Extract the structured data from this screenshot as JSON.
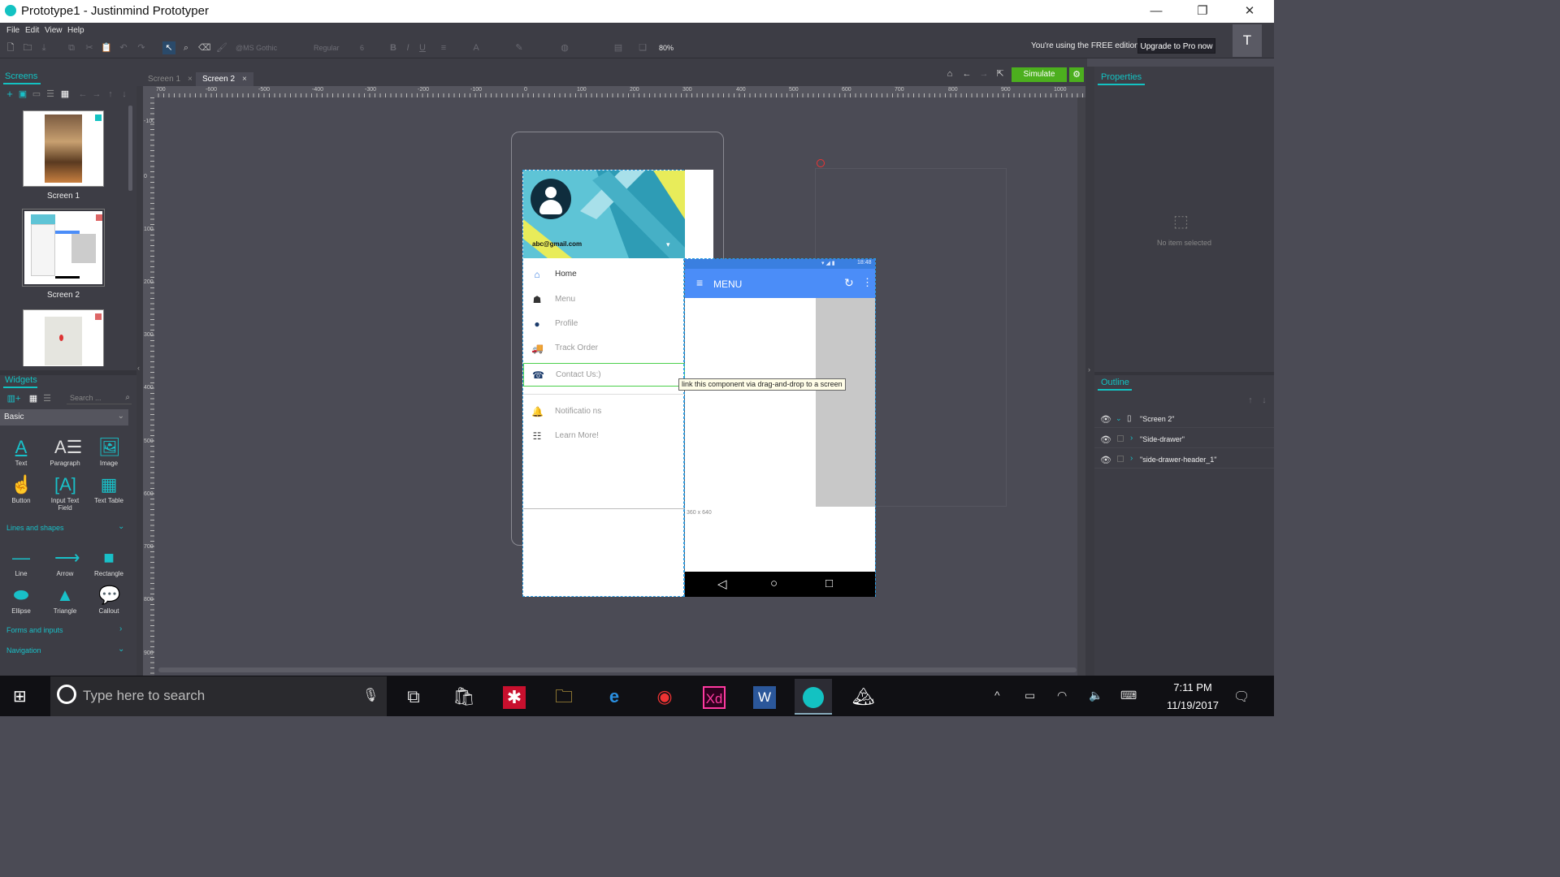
{
  "window": {
    "title": "Prototype1 - Justinmind Prototyper",
    "minimize": "—",
    "maximize": "❐",
    "close": "✕"
  },
  "menu": [
    "File",
    "Edit",
    "View",
    "Help"
  ],
  "toolbar": {
    "font_family": "@MS Gothic",
    "font_style": "Regular",
    "font_size": "6",
    "zoom": "80%",
    "free_edition_note": "You're using the FREE edition",
    "upgrade_label": "Upgrade to Pro now",
    "user_initial": "T"
  },
  "screens_panel": {
    "title": "Screens",
    "screens": [
      {
        "label": "Screen 1"
      },
      {
        "label": "Screen 2"
      },
      {
        "label": ""
      }
    ]
  },
  "widgets_panel": {
    "title": "Widgets",
    "search_placeholder": "Search ...",
    "category": "Basic",
    "basic": [
      "Text",
      "Paragraph",
      "Image",
      "Button",
      "Input Text Field",
      "Text Table"
    ],
    "lines_section": "Lines and shapes",
    "shapes": [
      "Line",
      "Arrow",
      "Rectangle",
      "Ellipse",
      "Triangle",
      "Callout"
    ],
    "forms_section": "Forms and inputs",
    "navigation_section": "Navigation"
  },
  "doc_tabs": [
    {
      "label": "Screen 1",
      "active": false
    },
    {
      "label": "Screen 2",
      "active": true
    }
  ],
  "simulate_label": "Simulate",
  "ruler_h": [
    "700",
    "-600",
    "-500",
    "-400",
    "-300",
    "-200",
    "-100",
    "0",
    "100",
    "200",
    "300",
    "400",
    "500",
    "600",
    "700",
    "800",
    "900",
    "1000"
  ],
  "ruler_v": [
    "-100",
    "0",
    "100",
    "200",
    "300",
    "400",
    "500",
    "600",
    "700",
    "800",
    "900"
  ],
  "canvas": {
    "drawer": {
      "email": "abc@gmail.com",
      "items": [
        {
          "label": "Home",
          "icon": "home-icon",
          "active": true
        },
        {
          "label": "Menu",
          "icon": "menu-food-icon"
        },
        {
          "label": "Profile",
          "icon": "profile-icon"
        },
        {
          "label": "Track Order",
          "icon": "track-order-icon"
        },
        {
          "label": "Contact Us:)",
          "icon": "contact-icon",
          "selected": true
        },
        {
          "label": "Notificatio ns",
          "icon": "bell-icon"
        },
        {
          "label": "Learn More!",
          "icon": "learn-more-icon"
        }
      ]
    },
    "appbar": {
      "title": "MENU",
      "time": "18:48"
    },
    "screen_size": "360 x 640",
    "tooltip": "link this component via drag-and-drop to a screen"
  },
  "properties_panel": {
    "title": "Properties",
    "empty_text": "No item selected"
  },
  "outline_panel": {
    "title": "Outline",
    "items": [
      "\"Screen 2\"",
      "\"Side-drawer\"",
      "\"side-drawer-header_1\""
    ]
  },
  "taskbar": {
    "search_placeholder": "Type here to search",
    "time": "7:11 PM",
    "date": "11/19/2017"
  },
  "colors": {
    "accent": "#13c2c2",
    "simulate": "#4caf1e",
    "appbar": "#4b8df8",
    "panel": "#3d3d45",
    "canvas": "#4b4b55"
  }
}
